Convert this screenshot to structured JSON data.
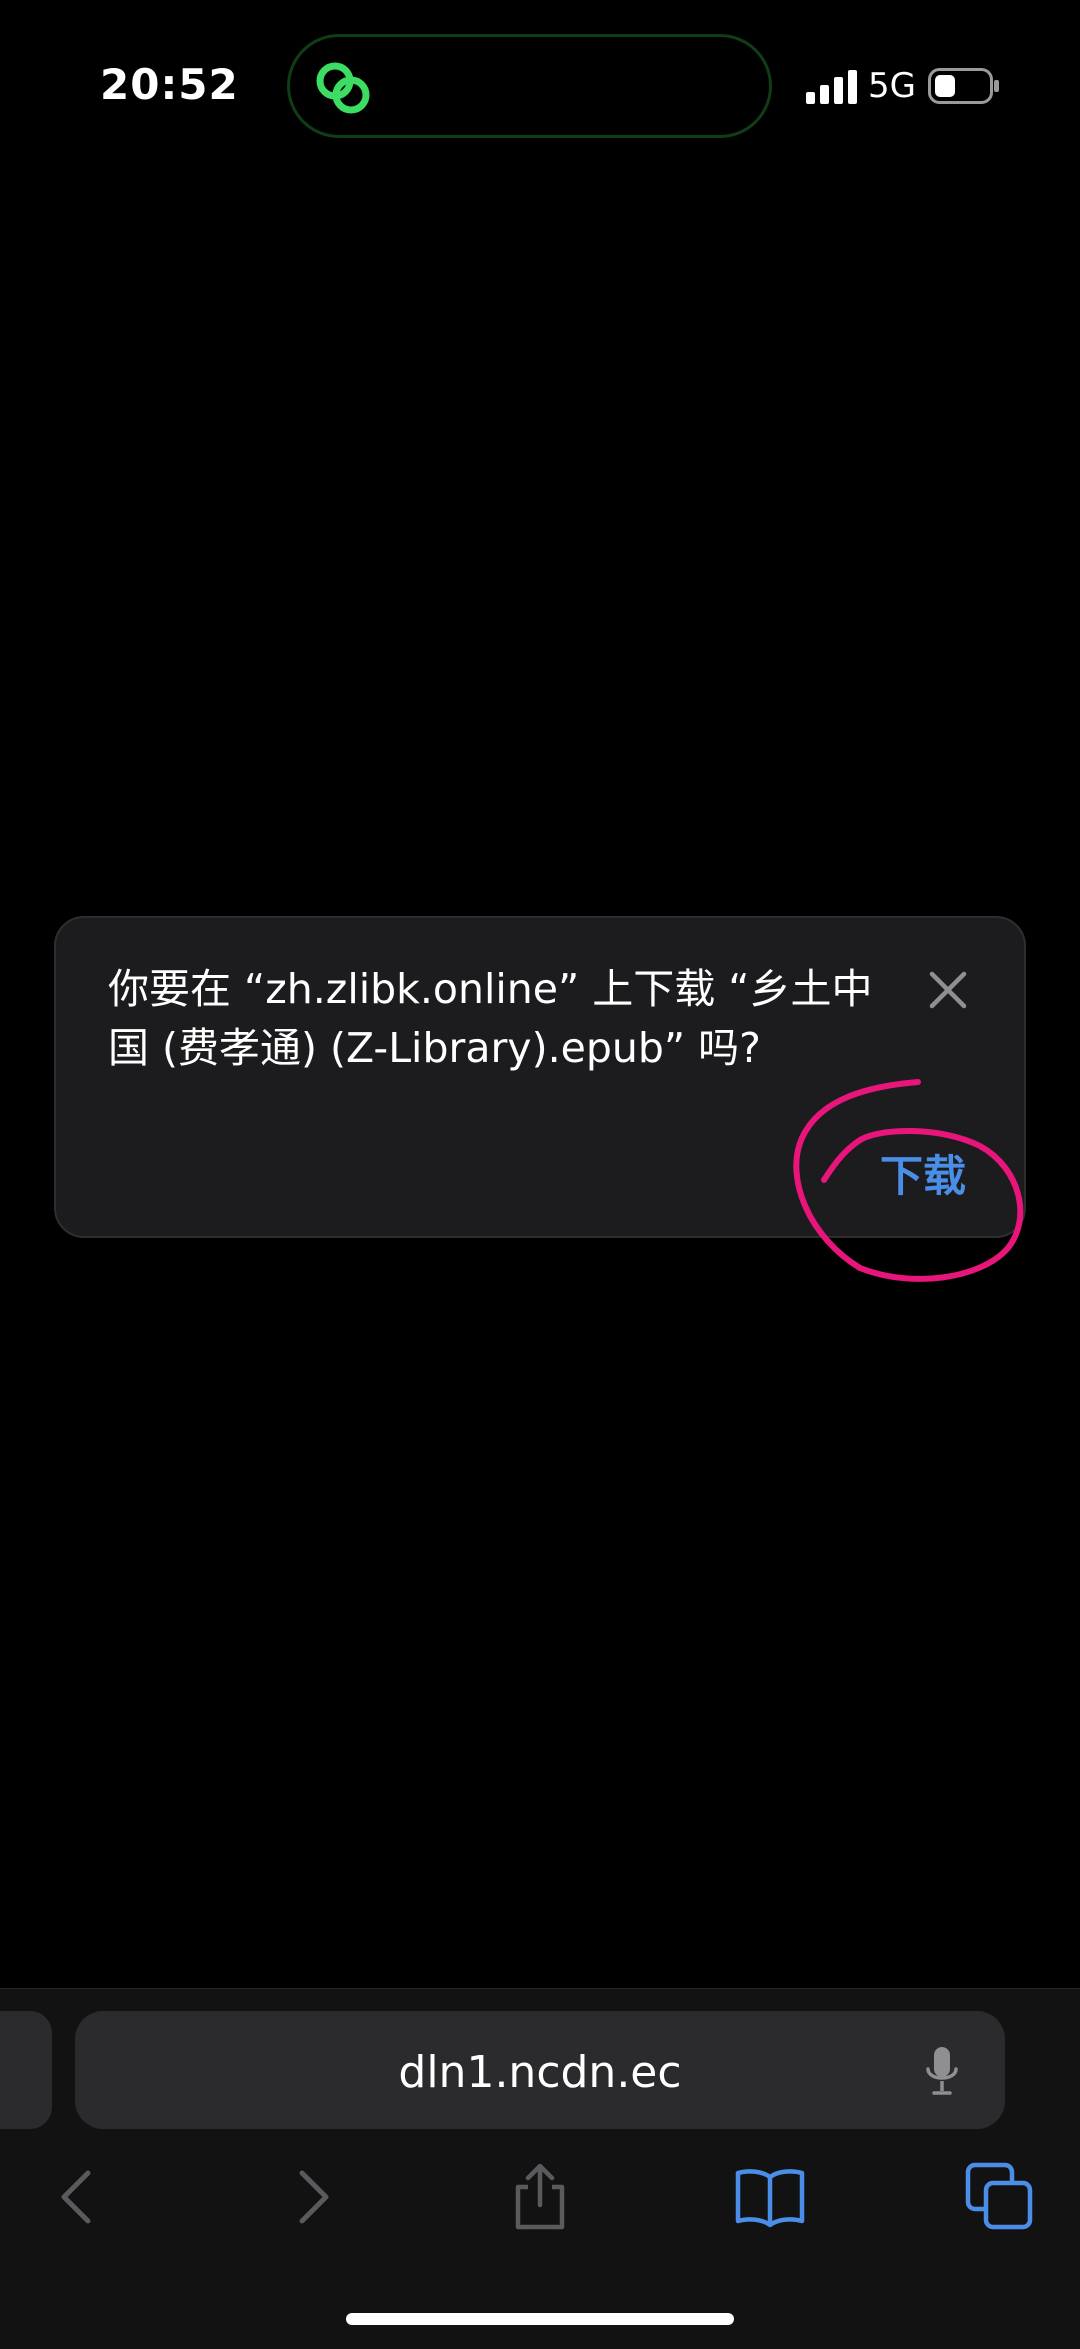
{
  "status_bar": {
    "time": "20:52",
    "network": "5G",
    "island_icon": "link-rings-icon",
    "island_color": "#3ddc63",
    "signal_icon": "cellular-signal-icon",
    "battery_icon": "battery-icon"
  },
  "dialog": {
    "message": "你要在 “zh.zlibk.online” 上下载 “乡土中国 (费孝通) (Z-Library).epub” 吗?",
    "close_icon": "close-icon",
    "download_label": "下载",
    "accent": "#4a8ee8",
    "annotation_color": "#e8157a"
  },
  "browser": {
    "address": "dln1.ncdn.ec",
    "mic_icon": "microphone-icon",
    "toolbar": [
      "back-icon",
      "forward-icon",
      "share-icon",
      "bookmarks-icon",
      "tabs-icon"
    ]
  }
}
